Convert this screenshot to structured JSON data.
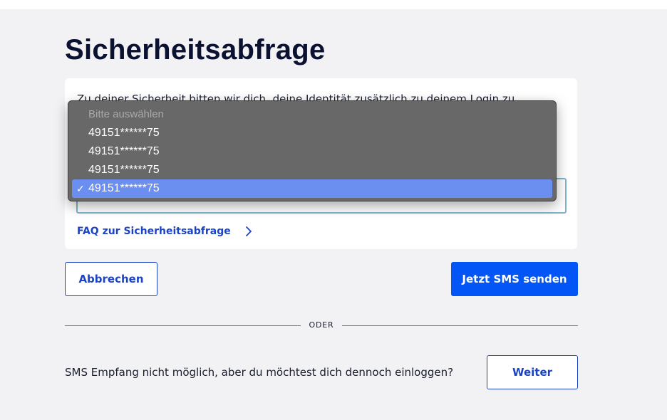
{
  "page": {
    "title": "Sicherheitsabfrage"
  },
  "card": {
    "intro_text": "Zu deiner Sicherheit bitten wir dich, deine Identität zusätzlich zu deinem Login zu",
    "faq_link": "FAQ zur Sicherheitsabfrage"
  },
  "dropdown": {
    "placeholder": "Bitte auswählen",
    "options": [
      "49151******75",
      "49151******75",
      "49151******75",
      "49151******75"
    ],
    "selected_index": 3,
    "check_mark": "✓"
  },
  "actions": {
    "cancel_label": "Abbrechen",
    "send_label": "Jetzt SMS senden"
  },
  "divider": {
    "label": "ODER"
  },
  "fallback": {
    "question": "SMS Empfang nicht möglich, aber du möchtest dich dennoch einloggen?",
    "continue_label": "Weiter"
  },
  "colors": {
    "title": "#0b1231",
    "link": "#1c43c6",
    "primary": "#0455f5",
    "background": "#f2f2f4",
    "selected_option": "#6b8ff0"
  }
}
